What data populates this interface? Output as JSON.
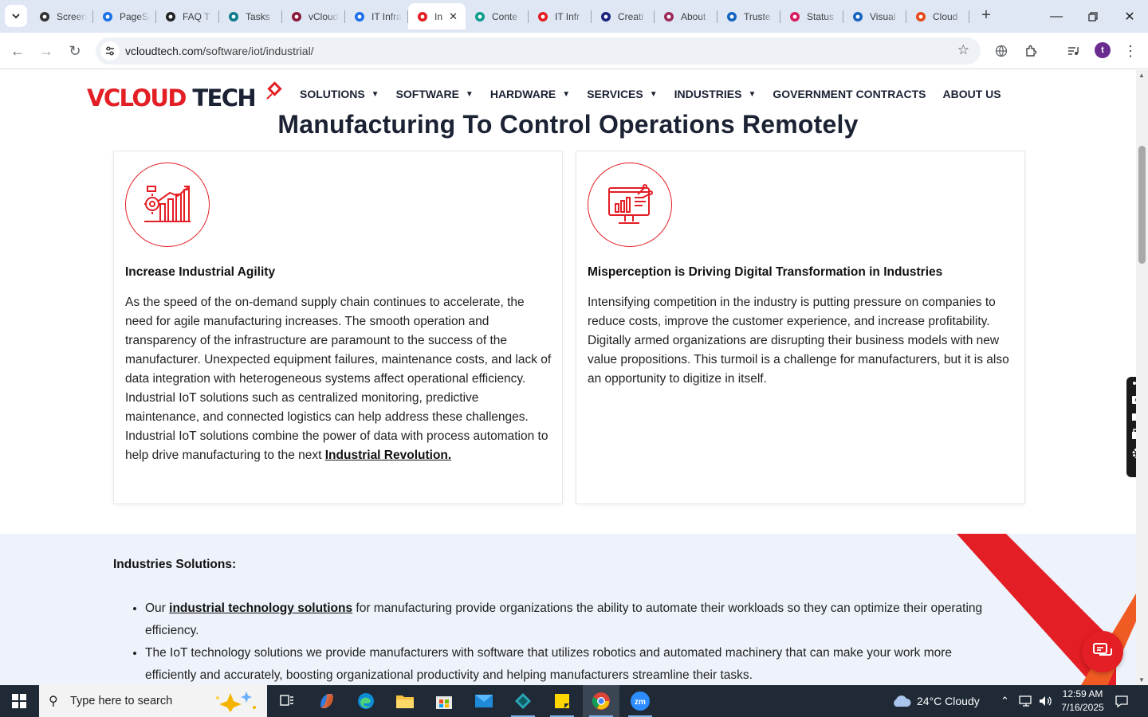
{
  "browser": {
    "tabs": [
      {
        "label": "Screenshot",
        "icon": "screenshot-app-icon"
      },
      {
        "label": "PageSpeed",
        "icon": "pagespeed-icon"
      },
      {
        "label": "FAQ T",
        "icon": "faq-icon"
      },
      {
        "label": "Tasks",
        "icon": "tasks-icon"
      },
      {
        "label": "vCloud",
        "icon": "vcloud-icon"
      },
      {
        "label": "IT Infra",
        "icon": "it-infra-icon"
      },
      {
        "label": "In",
        "icon": "vcloudtech-favicon",
        "active": true
      },
      {
        "label": "Conte",
        "icon": "content-icon"
      },
      {
        "label": "IT Infr",
        "icon": "vcloudtech-favicon"
      },
      {
        "label": "Creati",
        "icon": "create-icon"
      },
      {
        "label": "About",
        "icon": "about-icon"
      },
      {
        "label": "Truste",
        "icon": "trust-icon"
      },
      {
        "label": "Status",
        "icon": "status-icon"
      },
      {
        "label": "Visual",
        "icon": "visual-icon"
      },
      {
        "label": "Cloud",
        "icon": "cloud-icon"
      }
    ],
    "url_host": "vcloudtech.com",
    "url_path": "/software/iot/industrial/",
    "profile_initial": "t"
  },
  "site": {
    "logo": {
      "part1": "VCLOUD",
      "part2": "TECH"
    },
    "nav": [
      {
        "label": "SOLUTIONS",
        "dropdown": true
      },
      {
        "label": "SOFTWARE",
        "dropdown": true
      },
      {
        "label": "HARDWARE",
        "dropdown": true
      },
      {
        "label": "SERVICES",
        "dropdown": true
      },
      {
        "label": "INDUSTRIES",
        "dropdown": true
      },
      {
        "label": "GOVERNMENT CONTRACTS",
        "dropdown": false
      },
      {
        "label": "ABOUT US",
        "dropdown": false
      }
    ],
    "heading": "Manufacturing To Control Operations Remotely",
    "cards": [
      {
        "icon": "industrial-chart-icon",
        "title": "Increase Industrial Agility",
        "body": "As the speed of the on-demand supply chain continues to accelerate, the need for agile manufacturing increases. The smooth operation and transparency of the infrastructure are paramount to the success of the manufacturer. Unexpected equipment failures, maintenance costs, and lack of data integration with heterogeneous systems affect operational efficiency. Industrial IoT solutions such as centralized monitoring, predictive maintenance, and connected logistics can help address these challenges. Industrial IoT solutions combine the power of data with process automation to help drive manufacturing to the next ",
        "link": "Industrial Revolution."
      },
      {
        "icon": "digital-monitor-icon",
        "title": "Misperception is Driving Digital Transformation in Industries",
        "body": "Intensifying competition in the industry is putting pressure on companies to reduce costs, improve the customer experience, and increase profitability. Digitally armed organizations are disrupting their business models with new value propositions. This turmoil is a challenge for manufacturers, but it is also an opportunity to digitize in itself."
      }
    ],
    "solutions": {
      "title": "Industries Solutions:",
      "item1_prefix": "Our ",
      "item1_link": "industrial technology solutions",
      "item1_suffix": " for manufacturing provide organizations the ability to automate their workloads so they can optimize their operating efficiency.",
      "item2": "The IoT technology solutions we provide manufacturers with software that utilizes robotics and automated machinery that can make your work more efficiently and accurately, boosting organizational productivity and helping manufacturers streamline their tasks."
    }
  },
  "taskbar": {
    "search_placeholder": "Type here to search",
    "weather": "24°C  Cloudy",
    "time": "12:59 AM",
    "date": "7/16/2025"
  },
  "colors": {
    "brand_red": "#e31e24",
    "navy": "#1b2233"
  }
}
